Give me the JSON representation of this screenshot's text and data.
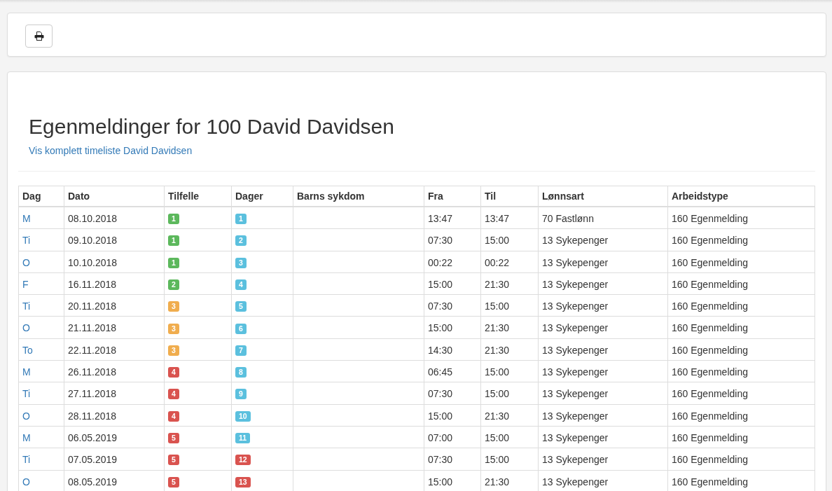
{
  "heading": {
    "title": "Egenmeldinger for 100 David Davidsen",
    "link": "Vis komplett timeliste David Davidsen"
  },
  "table": {
    "columns": [
      "Dag",
      "Dato",
      "Tilfelle",
      "Dager",
      "Barns sykdom",
      "Fra",
      "Til",
      "Lønnsart",
      "Arbeidstype"
    ],
    "rows": [
      {
        "dag": "M",
        "dato": "08.10.2018",
        "tilfelle": {
          "text": "1",
          "color": "#5cb85c"
        },
        "dager": {
          "text": "1",
          "color": "#5bc0de"
        },
        "barns_sykdom": "",
        "fra": "13:47",
        "til": "13:47",
        "lonnsart": "70 Fastlønn",
        "arbeidstype": "160 Egenmelding"
      },
      {
        "dag": "Ti",
        "dato": "09.10.2018",
        "tilfelle": {
          "text": "1",
          "color": "#5cb85c"
        },
        "dager": {
          "text": "2",
          "color": "#5bc0de"
        },
        "barns_sykdom": "",
        "fra": "07:30",
        "til": "15:00",
        "lonnsart": "13 Sykepenger",
        "arbeidstype": "160 Egenmelding"
      },
      {
        "dag": "O",
        "dato": "10.10.2018",
        "tilfelle": {
          "text": "1",
          "color": "#5cb85c"
        },
        "dager": {
          "text": "3",
          "color": "#5bc0de"
        },
        "barns_sykdom": "",
        "fra": "00:22",
        "til": "00:22",
        "lonnsart": "13 Sykepenger",
        "arbeidstype": "160 Egenmelding"
      },
      {
        "dag": "F",
        "dato": "16.11.2018",
        "tilfelle": {
          "text": "2",
          "color": "#5cb85c"
        },
        "dager": {
          "text": "4",
          "color": "#5bc0de"
        },
        "barns_sykdom": "",
        "fra": "15:00",
        "til": "21:30",
        "lonnsart": "13 Sykepenger",
        "arbeidstype": "160 Egenmelding"
      },
      {
        "dag": "Ti",
        "dato": "20.11.2018",
        "tilfelle": {
          "text": "3",
          "color": "#f0ad4e"
        },
        "dager": {
          "text": "5",
          "color": "#5bc0de"
        },
        "barns_sykdom": "",
        "fra": "07:30",
        "til": "15:00",
        "lonnsart": "13 Sykepenger",
        "arbeidstype": "160 Egenmelding"
      },
      {
        "dag": "O",
        "dato": "21.11.2018",
        "tilfelle": {
          "text": "3",
          "color": "#f0ad4e"
        },
        "dager": {
          "text": "6",
          "color": "#5bc0de"
        },
        "barns_sykdom": "",
        "fra": "15:00",
        "til": "21:30",
        "lonnsart": "13 Sykepenger",
        "arbeidstype": "160 Egenmelding"
      },
      {
        "dag": "To",
        "dato": "22.11.2018",
        "tilfelle": {
          "text": "3",
          "color": "#f0ad4e"
        },
        "dager": {
          "text": "7",
          "color": "#5bc0de"
        },
        "barns_sykdom": "",
        "fra": "14:30",
        "til": "21:30",
        "lonnsart": "13 Sykepenger",
        "arbeidstype": "160 Egenmelding"
      },
      {
        "dag": "M",
        "dato": "26.11.2018",
        "tilfelle": {
          "text": "4",
          "color": "#d9534f"
        },
        "dager": {
          "text": "8",
          "color": "#5bc0de"
        },
        "barns_sykdom": "",
        "fra": "06:45",
        "til": "15:00",
        "lonnsart": "13 Sykepenger",
        "arbeidstype": "160 Egenmelding"
      },
      {
        "dag": "Ti",
        "dato": "27.11.2018",
        "tilfelle": {
          "text": "4",
          "color": "#d9534f"
        },
        "dager": {
          "text": "9",
          "color": "#5bc0de"
        },
        "barns_sykdom": "",
        "fra": "07:30",
        "til": "15:00",
        "lonnsart": "13 Sykepenger",
        "arbeidstype": "160 Egenmelding"
      },
      {
        "dag": "O",
        "dato": "28.11.2018",
        "tilfelle": {
          "text": "4",
          "color": "#d9534f"
        },
        "dager": {
          "text": "10",
          "color": "#5bc0de"
        },
        "barns_sykdom": "",
        "fra": "15:00",
        "til": "21:30",
        "lonnsart": "13 Sykepenger",
        "arbeidstype": "160 Egenmelding"
      },
      {
        "dag": "M",
        "dato": "06.05.2019",
        "tilfelle": {
          "text": "5",
          "color": "#d9534f"
        },
        "dager": {
          "text": "11",
          "color": "#5bc0de"
        },
        "barns_sykdom": "",
        "fra": "07:00",
        "til": "15:00",
        "lonnsart": "13 Sykepenger",
        "arbeidstype": "160 Egenmelding"
      },
      {
        "dag": "Ti",
        "dato": "07.05.2019",
        "tilfelle": {
          "text": "5",
          "color": "#d9534f"
        },
        "dager": {
          "text": "12",
          "color": "#d9534f"
        },
        "barns_sykdom": "",
        "fra": "07:30",
        "til": "15:00",
        "lonnsart": "13 Sykepenger",
        "arbeidstype": "160 Egenmelding"
      },
      {
        "dag": "O",
        "dato": "08.05.2019",
        "tilfelle": {
          "text": "5",
          "color": "#d9534f"
        },
        "dager": {
          "text": "13",
          "color": "#d9534f"
        },
        "barns_sykdom": "",
        "fra": "15:00",
        "til": "21:30",
        "lonnsart": "13 Sykepenger",
        "arbeidstype": "160 Egenmelding"
      }
    ]
  }
}
